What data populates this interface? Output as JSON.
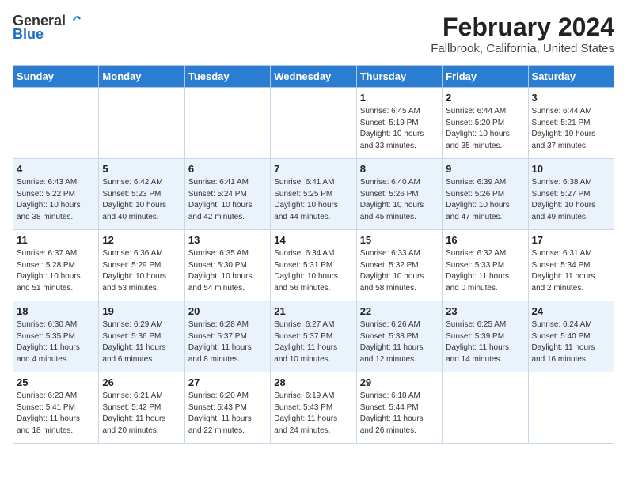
{
  "header": {
    "logo_general": "General",
    "logo_blue": "Blue",
    "title": "February 2024",
    "subtitle": "Fallbrook, California, United States"
  },
  "days_of_week": [
    "Sunday",
    "Monday",
    "Tuesday",
    "Wednesday",
    "Thursday",
    "Friday",
    "Saturday"
  ],
  "weeks": [
    [
      {
        "day": "",
        "content": ""
      },
      {
        "day": "",
        "content": ""
      },
      {
        "day": "",
        "content": ""
      },
      {
        "day": "",
        "content": ""
      },
      {
        "day": "1",
        "content": "Sunrise: 6:45 AM\nSunset: 5:19 PM\nDaylight: 10 hours\nand 33 minutes."
      },
      {
        "day": "2",
        "content": "Sunrise: 6:44 AM\nSunset: 5:20 PM\nDaylight: 10 hours\nand 35 minutes."
      },
      {
        "day": "3",
        "content": "Sunrise: 6:44 AM\nSunset: 5:21 PM\nDaylight: 10 hours\nand 37 minutes."
      }
    ],
    [
      {
        "day": "4",
        "content": "Sunrise: 6:43 AM\nSunset: 5:22 PM\nDaylight: 10 hours\nand 38 minutes."
      },
      {
        "day": "5",
        "content": "Sunrise: 6:42 AM\nSunset: 5:23 PM\nDaylight: 10 hours\nand 40 minutes."
      },
      {
        "day": "6",
        "content": "Sunrise: 6:41 AM\nSunset: 5:24 PM\nDaylight: 10 hours\nand 42 minutes."
      },
      {
        "day": "7",
        "content": "Sunrise: 6:41 AM\nSunset: 5:25 PM\nDaylight: 10 hours\nand 44 minutes."
      },
      {
        "day": "8",
        "content": "Sunrise: 6:40 AM\nSunset: 5:26 PM\nDaylight: 10 hours\nand 45 minutes."
      },
      {
        "day": "9",
        "content": "Sunrise: 6:39 AM\nSunset: 5:26 PM\nDaylight: 10 hours\nand 47 minutes."
      },
      {
        "day": "10",
        "content": "Sunrise: 6:38 AM\nSunset: 5:27 PM\nDaylight: 10 hours\nand 49 minutes."
      }
    ],
    [
      {
        "day": "11",
        "content": "Sunrise: 6:37 AM\nSunset: 5:28 PM\nDaylight: 10 hours\nand 51 minutes."
      },
      {
        "day": "12",
        "content": "Sunrise: 6:36 AM\nSunset: 5:29 PM\nDaylight: 10 hours\nand 53 minutes."
      },
      {
        "day": "13",
        "content": "Sunrise: 6:35 AM\nSunset: 5:30 PM\nDaylight: 10 hours\nand 54 minutes."
      },
      {
        "day": "14",
        "content": "Sunrise: 6:34 AM\nSunset: 5:31 PM\nDaylight: 10 hours\nand 56 minutes."
      },
      {
        "day": "15",
        "content": "Sunrise: 6:33 AM\nSunset: 5:32 PM\nDaylight: 10 hours\nand 58 minutes."
      },
      {
        "day": "16",
        "content": "Sunrise: 6:32 AM\nSunset: 5:33 PM\nDaylight: 11 hours\nand 0 minutes."
      },
      {
        "day": "17",
        "content": "Sunrise: 6:31 AM\nSunset: 5:34 PM\nDaylight: 11 hours\nand 2 minutes."
      }
    ],
    [
      {
        "day": "18",
        "content": "Sunrise: 6:30 AM\nSunset: 5:35 PM\nDaylight: 11 hours\nand 4 minutes."
      },
      {
        "day": "19",
        "content": "Sunrise: 6:29 AM\nSunset: 5:36 PM\nDaylight: 11 hours\nand 6 minutes."
      },
      {
        "day": "20",
        "content": "Sunrise: 6:28 AM\nSunset: 5:37 PM\nDaylight: 11 hours\nand 8 minutes."
      },
      {
        "day": "21",
        "content": "Sunrise: 6:27 AM\nSunset: 5:37 PM\nDaylight: 11 hours\nand 10 minutes."
      },
      {
        "day": "22",
        "content": "Sunrise: 6:26 AM\nSunset: 5:38 PM\nDaylight: 11 hours\nand 12 minutes."
      },
      {
        "day": "23",
        "content": "Sunrise: 6:25 AM\nSunset: 5:39 PM\nDaylight: 11 hours\nand 14 minutes."
      },
      {
        "day": "24",
        "content": "Sunrise: 6:24 AM\nSunset: 5:40 PM\nDaylight: 11 hours\nand 16 minutes."
      }
    ],
    [
      {
        "day": "25",
        "content": "Sunrise: 6:23 AM\nSunset: 5:41 PM\nDaylight: 11 hours\nand 18 minutes."
      },
      {
        "day": "26",
        "content": "Sunrise: 6:21 AM\nSunset: 5:42 PM\nDaylight: 11 hours\nand 20 minutes."
      },
      {
        "day": "27",
        "content": "Sunrise: 6:20 AM\nSunset: 5:43 PM\nDaylight: 11 hours\nand 22 minutes."
      },
      {
        "day": "28",
        "content": "Sunrise: 6:19 AM\nSunset: 5:43 PM\nDaylight: 11 hours\nand 24 minutes."
      },
      {
        "day": "29",
        "content": "Sunrise: 6:18 AM\nSunset: 5:44 PM\nDaylight: 11 hours\nand 26 minutes."
      },
      {
        "day": "",
        "content": ""
      },
      {
        "day": "",
        "content": ""
      }
    ]
  ]
}
